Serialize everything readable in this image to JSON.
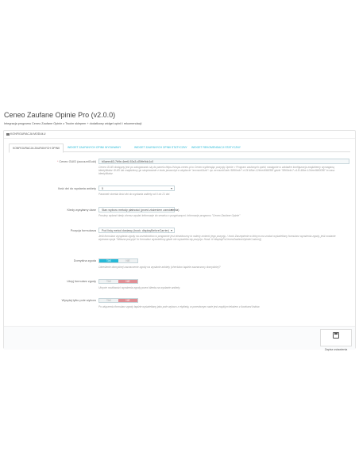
{
  "page": {
    "title": "Ceneo Zaufane Opinie Pro (v2.0.0)",
    "description": "Integracja programu Ceneo Zaufane Opinie z Twoim sklepem + dodatkowy widget opinii i rekomendacji"
  },
  "panel": {
    "header": "Konfiguracja modułu",
    "header_icon": "cog-icon"
  },
  "tabs": [
    {
      "label": "Konfiguracja zaufanych opinii",
      "active": true
    },
    {
      "label": "Widget zaufanych opinii wysuwany",
      "active": false
    },
    {
      "label": "Widget zaufanych opinii statyczny",
      "active": false
    },
    {
      "label": "Widget rekomendacji statyczny",
      "active": false
    }
  ],
  "fields": {
    "guid": {
      "label": "Ceneo GUID (accountGuid)",
      "required": true,
      "value": "b0aeec63-7b9e-4ee6-92a3-d39fe9dc1c0",
      "help": "Ceneo GUID dostępny jest po zalogowaniu się do panelu https://shops.ceneo.pl w Ceneo wybierając pozycję Opinie > Program zaufanych opinii, następnie w zakładce konfiguracja znajdziemy wymaganą identyfikator GUID lub znajdziemy go skopiowanie z kodu javascript w atrybucie \"accountGuid\": np. accountGuid='5860e4c7-c13f-48be-124ee4660f3f8' gdzie \"5860e4c7-c13f-48be-124ee4660f3f8\" to nasz identyfikator."
    },
    "days": {
      "label": "Ilość dni do wysłania ankiety",
      "value": "5",
      "help": "Parametr określa ilość dni do wysłania ankiety od 0 do 21 dni."
    },
    "status": {
      "label": "Kiedy wysyłamy dane",
      "value": "Stan wyboru metody płatności (przed złożeniem zamówienia)",
      "help": "Prosimy wybrać kiedy chcesz wysłać informacje do serwisu o przypisanymi. Informacje programu \"Ceneo Zaufane Opinie\""
    },
    "hook": {
      "label": "Pozycja formularza",
      "value": "Pod listą metod dostawy (hook: displayBeforeCarrier)",
      "help": "Jeśli formularz wysyłania zgody na uczestnictwo w programie jest niewidoczny to należy zmienić jego pozycję. / hook Zaczepienie w którym ma zostać wyświetlony formularz wyrażenia zgody, jeśli zostanie wybrana opcja \"Własna pozycja\" to formularz wyświetlony gdzie nie wyświetla się pozycja. Hook: #+displayPsCeneoZaufaneOpinieCustom}}"
    },
    "default_consent": {
      "label": "Domyślna zgoda",
      "yes": "TAK",
      "no": "NIE",
      "selected": "yes",
      "help": "Określenie domyślnej zaznaczenie zgody na wysłanie ankiety (checkbox będzie zaznaczony domyślnie)?"
    },
    "hide_form": {
      "label": "Ukryj formularz zgody",
      "yes": "TAK",
      "no": "NIE",
      "selected": "no",
      "help": "Ukrycie możliwości wyrażenia zgody przez klienta na wysłanie ankiety."
    },
    "only_products": {
      "label": "Wysyłaj tylko pole wyboru",
      "yes": "TAK",
      "no": "NIE",
      "selected": "no",
      "help": "Po włączeniu formularz zgody będzie wyświetlany jako pole wyboru z etykietą, w przeciwnym razie jest zwykłym tekstem z ikonkami linków."
    }
  },
  "footer": {
    "save_label": "Zapisz ustawienia",
    "save_icon": "save-icon"
  }
}
